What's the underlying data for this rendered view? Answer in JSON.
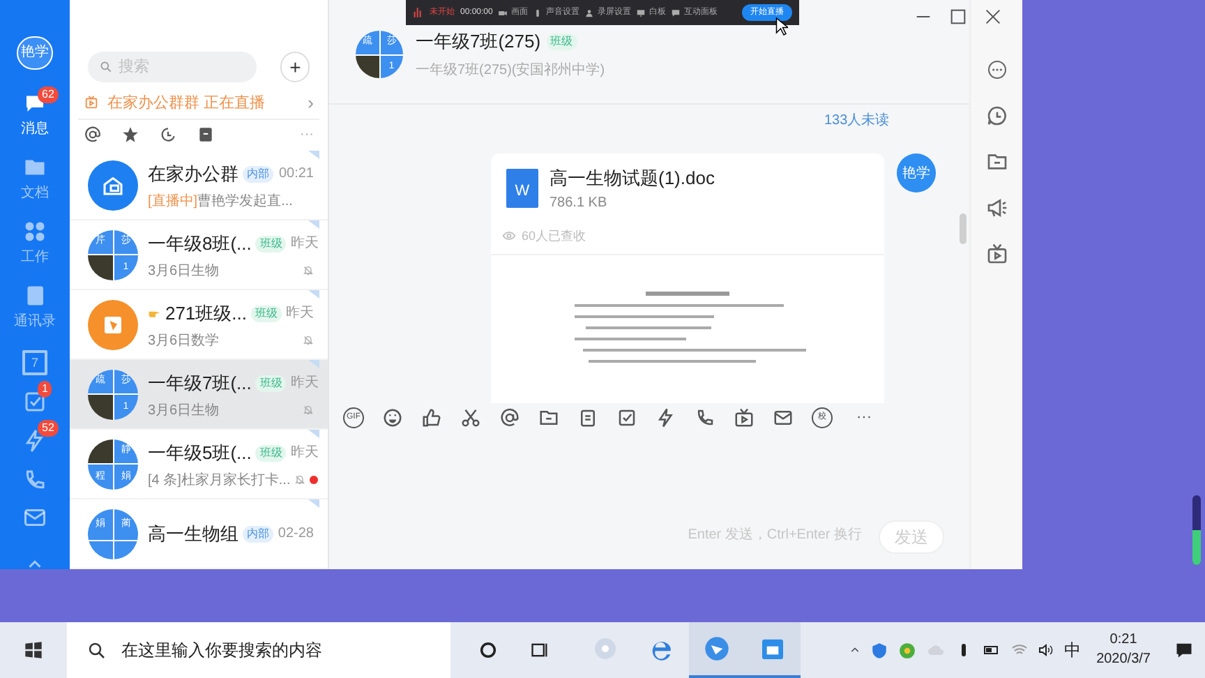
{
  "nav": {
    "avatar": "艳学",
    "items": [
      {
        "kind": "message",
        "label": "消息",
        "badge": "62",
        "selected": true
      },
      {
        "kind": "docs",
        "label": "文档",
        "selected": false
      },
      {
        "kind": "work",
        "label": "工作",
        "selected": false
      },
      {
        "kind": "contacts",
        "label": "通讯录",
        "selected": false
      },
      {
        "kind": "calendar",
        "text": "7",
        "selected": false
      },
      {
        "kind": "task",
        "badge": "1",
        "selected": false
      },
      {
        "kind": "flash",
        "badge": "52",
        "selected": false
      },
      {
        "kind": "phone",
        "selected": false
      },
      {
        "kind": "mail",
        "selected": false
      },
      {
        "kind": "more",
        "selected": false
      }
    ]
  },
  "list": {
    "search_placeholder": "搜索",
    "add": "+",
    "live_banner": {
      "text": "在家办公群群 正在直播",
      "arrow": "›"
    },
    "filters": [
      {
        "kind": "at"
      },
      {
        "kind": "star"
      },
      {
        "kind": "clock"
      },
      {
        "kind": "archive"
      }
    ],
    "filters_more": "···",
    "chats": [
      {
        "avatar": {
          "kind": "group"
        },
        "name": "在家办公群",
        "tag": {
          "text": "内部",
          "kind": "internal"
        },
        "time": "00:21",
        "preview_prefix": "[直播中]",
        "preview": "曹艳学发起直...",
        "muted": false,
        "unread": false,
        "selected": false
      },
      {
        "avatar": {
          "kind": "grid",
          "cells": [
            {
              "kind": "text",
              "text": "芹"
            },
            {
              "kind": "text",
              "text": "莎"
            },
            {
              "kind": "photo"
            },
            {
              "kind": "text",
              "text": "1"
            }
          ]
        },
        "name": "一年级8班(...",
        "tag": {
          "text": "班级",
          "kind": "class"
        },
        "time": "昨天",
        "preview": "3月6日生物",
        "muted": true,
        "unread": false,
        "selected": false
      },
      {
        "avatar": {
          "kind": "book"
        },
        "name_icon": {
          "kind": "pointing-hand"
        },
        "name": "271班级...",
        "tag": {
          "text": "班级",
          "kind": "class"
        },
        "time": "昨天",
        "preview": "3月6日数学",
        "muted": true,
        "unread": false,
        "selected": false
      },
      {
        "avatar": {
          "kind": "grid",
          "cells": [
            {
              "kind": "text",
              "text": "疏"
            },
            {
              "kind": "text",
              "text": "莎"
            },
            {
              "kind": "photo"
            },
            {
              "kind": "text",
              "text": "1"
            }
          ]
        },
        "name": "一年级7班(...",
        "tag": {
          "text": "班级",
          "kind": "class"
        },
        "time": "昨天",
        "preview": "3月6日生物",
        "muted": true,
        "unread": false,
        "selected": true
      },
      {
        "avatar": {
          "kind": "grid",
          "cells": [
            {
              "kind": "photo"
            },
            {
              "kind": "text",
              "text": "静"
            },
            {
              "kind": "text",
              "text": "程"
            },
            {
              "kind": "text",
              "text": "娟"
            }
          ]
        },
        "name": "一年级5班(...",
        "tag": {
          "text": "班级",
          "kind": "class"
        },
        "time": "昨天",
        "preview": "[4 条]杜家月家长打卡...",
        "muted": true,
        "unread": true,
        "selected": false
      },
      {
        "avatar": {
          "kind": "grid",
          "cells": [
            {
              "kind": "text",
              "text": "娟"
            },
            {
              "kind": "text",
              "text": "蔺"
            },
            {
              "kind": "blank"
            },
            {
              "kind": "blank"
            }
          ]
        },
        "name": "高一生物组",
        "tag": {
          "text": "内部",
          "kind": "internal"
        },
        "time": "02-28",
        "muted": false,
        "unread": false,
        "selected": false
      }
    ]
  },
  "recorder": {
    "status": "未开始",
    "timer": "00:00:00",
    "items": [
      {
        "kind": "camera",
        "label": "画面"
      },
      {
        "kind": "mic",
        "label": "声音设置"
      },
      {
        "kind": "person",
        "label": "录屏设置"
      },
      {
        "kind": "board",
        "label": "白板"
      },
      {
        "kind": "chat",
        "label": "互动面板"
      }
    ],
    "start": "开始直播"
  },
  "chat": {
    "title": "一年级7班(275)",
    "tag": "班级",
    "subtitle": "一年级7班(275)(安国祁州中学)",
    "avatar": {
      "kind": "grid",
      "cells": [
        {
          "kind": "text",
          "text": "疏"
        },
        {
          "kind": "text",
          "text": "莎"
        },
        {
          "kind": "photo"
        },
        {
          "kind": "text",
          "text": "1"
        }
      ]
    },
    "unread": "133人未读",
    "message": {
      "sender": "艳学",
      "file_name": "高一生物试题(1).doc",
      "file_icon": "W",
      "file_size": "786.1 KB",
      "received": "60人已查收"
    },
    "toolbar": [
      {
        "kind": "gif",
        "label": "GIF"
      },
      {
        "kind": "emoji"
      },
      {
        "kind": "thumb"
      },
      {
        "kind": "scissors"
      },
      {
        "kind": "at"
      },
      {
        "kind": "folder"
      },
      {
        "kind": "note"
      },
      {
        "kind": "check"
      },
      {
        "kind": "flash"
      },
      {
        "kind": "phone"
      },
      {
        "kind": "tv"
      },
      {
        "kind": "mail"
      },
      {
        "kind": "school",
        "label": "校"
      },
      {
        "kind": "more",
        "label": "···"
      }
    ],
    "hint": "Enter 发送，Ctrl+Enter 换行",
    "send": "发送"
  },
  "side_tools": [
    {
      "kind": "more"
    },
    {
      "kind": "history"
    },
    {
      "kind": "folder"
    },
    {
      "kind": "announce"
    },
    {
      "kind": "tv"
    }
  ],
  "window_controls": [
    {
      "kind": "minimize"
    },
    {
      "kind": "maximize"
    },
    {
      "kind": "close"
    }
  ],
  "desktop": {
    "volume_meter": {
      "level": 0.5
    }
  },
  "taskbar": {
    "search_placeholder": "在这里输入你要搜索的内容",
    "apps": [
      {
        "kind": "pinwheel",
        "active": false
      },
      {
        "kind": "edge",
        "active": false
      },
      {
        "kind": "bird",
        "active": true
      },
      {
        "kind": "app",
        "active": true
      }
    ],
    "ime": "中",
    "time": "0:21",
    "date": "2020/3/7"
  }
}
